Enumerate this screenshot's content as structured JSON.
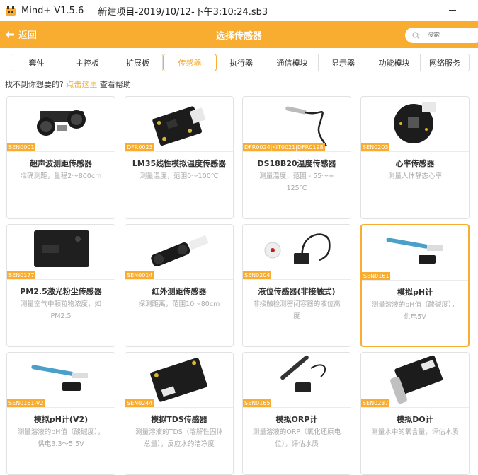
{
  "window": {
    "app_name": "Mind+ V1.5.6",
    "project_name": "新建项目-2019/10/12-下午3:10:24.sb3"
  },
  "header": {
    "back_label": "返回",
    "title": "选择传感器",
    "search_placeholder": "搜索"
  },
  "tabs": [
    {
      "label": "套件"
    },
    {
      "label": "主控板"
    },
    {
      "label": "扩展板"
    },
    {
      "label": "传感器",
      "active": true
    },
    {
      "label": "执行器"
    },
    {
      "label": "通信模块"
    },
    {
      "label": "显示器"
    },
    {
      "label": "功能模块"
    },
    {
      "label": "网络服务"
    }
  ],
  "help": {
    "prefix": "找不到你想要的?",
    "link": "点击这里",
    "suffix": "查看帮助"
  },
  "colors": {
    "accent": "#f8ad31"
  },
  "cards": [
    {
      "code": "SEN0001",
      "name": "超声波测距传感器",
      "desc": "准确测距，量程2～800cm",
      "icon": "ultrasonic-sensor-image"
    },
    {
      "code": "DFR0023",
      "name": "LM35线性模拟温度传感器",
      "desc": "测量温度，范围0～100℃",
      "icon": "lm35-sensor-image"
    },
    {
      "code": "DFR0024|KIT0021|DFR0198",
      "name": "DS18B20温度传感器",
      "desc": "测量温度，范围 - 55～+ 125℃",
      "icon": "ds18b20-probe-image"
    },
    {
      "code": "SEN0203",
      "name": "心率传感器",
      "desc": "测量人体静态心率",
      "icon": "heart-rate-sensor-image"
    },
    {
      "code": "SEN0177",
      "name": "PM2.5激光粉尘传感器",
      "desc": "测量空气中颗粒物浓度，如PM2.5",
      "icon": "pm25-sensor-image"
    },
    {
      "code": "SEN0014",
      "name": "红外测距传感器",
      "desc": "探测距离，范围10～80cm",
      "icon": "ir-distance-sensor-image"
    },
    {
      "code": "SEN0204",
      "name": "液位传感器(非接触式)",
      "desc": "非接触检测密闭容器的液位高度",
      "icon": "liquid-level-sensor-image"
    },
    {
      "code": "SEN0161",
      "name": "模拟pH计",
      "desc": "测量溶液的pH值（酸碱度），供电5V",
      "icon": "ph-meter-image",
      "selected": true
    },
    {
      "code": "SEN0161-V2",
      "name": "模拟pH计(V2)",
      "desc": "测量溶液的pH值（酸碱度），供电3.3～5.5V",
      "icon": "ph-meter-v2-image"
    },
    {
      "code": "SEN0244",
      "name": "模拟TDS传感器",
      "desc": "测量溶液的TDS（溶解性固体总量），反应水的洁净度",
      "icon": "tds-sensor-image"
    },
    {
      "code": "SEN0165",
      "name": "模拟ORP计",
      "desc": "测量溶液的ORP（氧化还原电位），评估水质",
      "icon": "orp-meter-image"
    },
    {
      "code": "SEN0237",
      "name": "模拟DO计",
      "desc": "测量水中的氧含量，评估水质",
      "icon": "do-meter-image"
    }
  ]
}
